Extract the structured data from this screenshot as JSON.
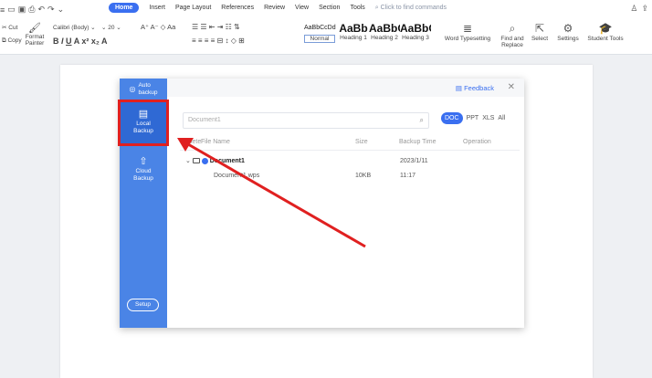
{
  "topbar": {
    "tabs": [
      "Home",
      "Insert",
      "Page Layout",
      "References",
      "Review",
      "View",
      "Section",
      "Tools"
    ],
    "active_tab": "Home",
    "command_search": "Click to find commands"
  },
  "ribbon": {
    "cut": "Cut",
    "copy": "Copy",
    "format_painter_1": "Format",
    "format_painter_2": "Painter",
    "font_name": "Calibri (Body)",
    "font_size": "20",
    "styles": [
      {
        "preview": "AaBbCcDd",
        "name": "Normal"
      },
      {
        "preview": "AaBb",
        "name": "Heading 1"
      },
      {
        "preview": "AaBbC",
        "name": "Heading 2"
      },
      {
        "preview": "AaBbC",
        "name": "Heading 3"
      }
    ],
    "word_typesetting": "Word Typesetting",
    "find_replace_1": "Find and",
    "find_replace_2": "Replace",
    "select": "Select",
    "settings": "Settings",
    "student_tools": "Student Tools"
  },
  "dialog": {
    "sidebar": {
      "auto_backup_1": "Auto",
      "auto_backup_2": "backup",
      "local_backup_1": "Local",
      "local_backup_2": "Backup",
      "cloud_backup_1": "Cloud",
      "cloud_backup_2": "Backup",
      "setup": "Setup"
    },
    "feedback": "Feedback",
    "search_placeholder": "Document1",
    "filters": [
      "DOC",
      "PPT",
      "XLS",
      "All"
    ],
    "columns": {
      "delete": "Delete",
      "file_name": "File Name",
      "size": "Size",
      "backup_time": "Backup Time",
      "operation": "Operation"
    },
    "group": {
      "name": "Document1",
      "date": "2023/1/11"
    },
    "files": [
      {
        "name": "Document1.wps",
        "size": "10KB",
        "time": "11:17"
      }
    ]
  },
  "colors": {
    "accent": "#3a6ff0",
    "sidebar": "#4a84e6",
    "sidebar_active": "#2f69d4",
    "highlight": "#e02020"
  }
}
